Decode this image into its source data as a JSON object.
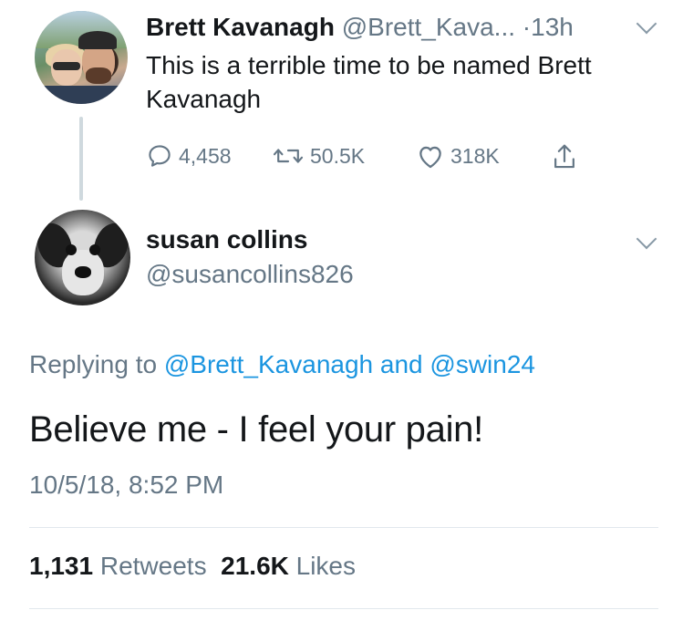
{
  "reply_to_tweet": {
    "name": "Brett Kavanagh",
    "handle": "@Brett_Kava...",
    "time_sep": "·",
    "time": "13h",
    "text": "This is a terrible time to be named Brett Kavanagh",
    "replies": "4,458",
    "retweets": "50.5K",
    "likes": "318K"
  },
  "tweet": {
    "name": "susan collins",
    "handle": "@susancollins826",
    "replying_prefix": "Replying to",
    "replying_user1": "@Brett_Kavanagh",
    "replying_and": "and",
    "replying_user2": "@swin24",
    "text": "Believe me - I feel your pain!",
    "timestamp": "10/5/18, 8:52 PM",
    "retweet_count": "1,131",
    "retweet_label": "Retweets",
    "like_count": "21.6K",
    "like_label": "Likes"
  },
  "colors": {
    "link": "#1b95e0",
    "secondary_text": "#657786",
    "primary_text": "#14171a"
  },
  "icons": [
    "reply-icon",
    "retweet-icon",
    "like-icon",
    "share-icon",
    "chevron-down-icon"
  ]
}
